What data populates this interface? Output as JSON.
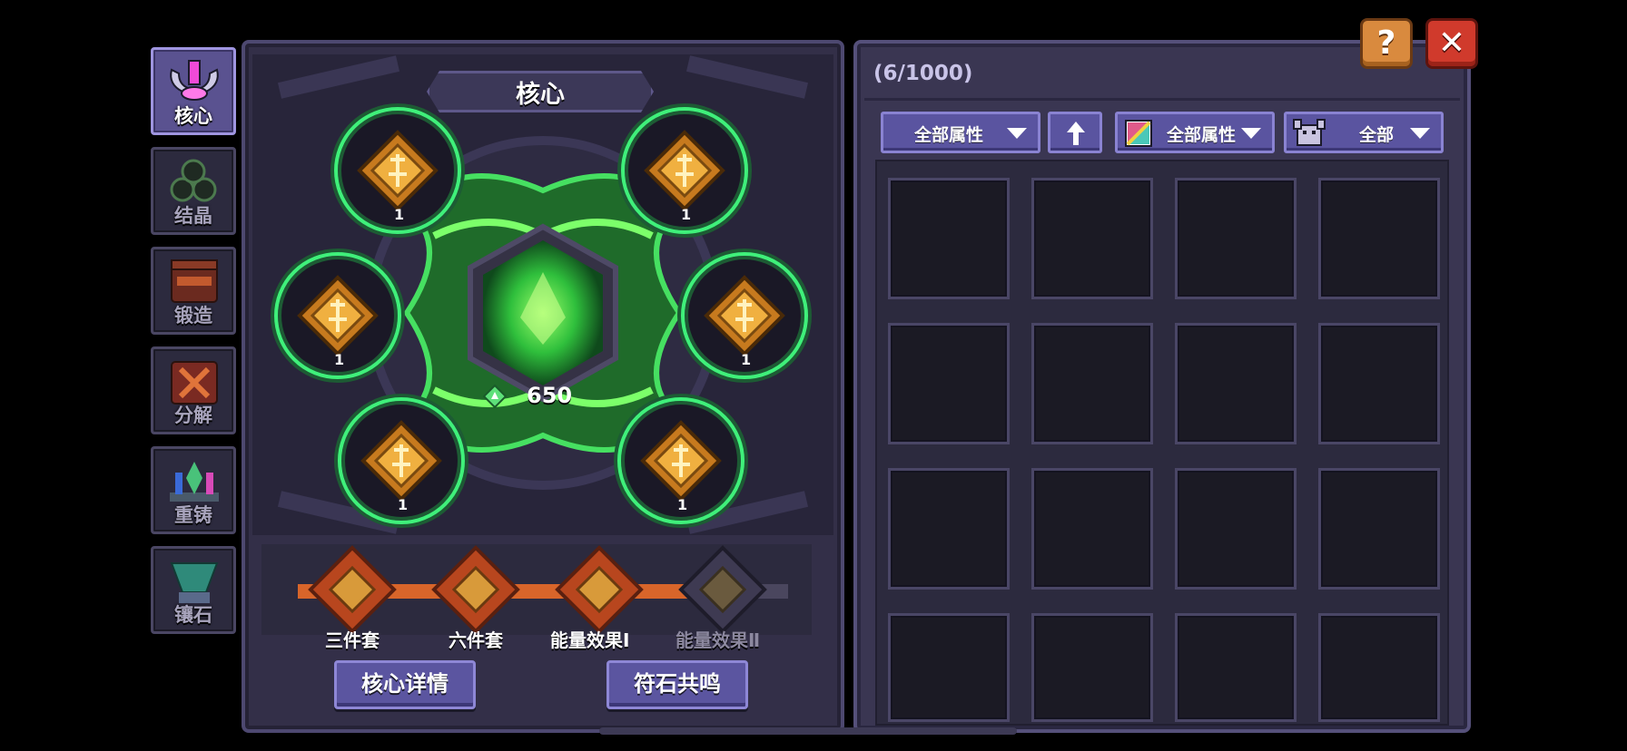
{
  "tabs": [
    {
      "label": "核心",
      "icon": "core-vase-icon",
      "active": true
    },
    {
      "label": "结晶",
      "icon": "crystal-icon",
      "active": false
    },
    {
      "label": "锻造",
      "icon": "forge-icon",
      "active": false
    },
    {
      "label": "分解",
      "icon": "decompose-icon",
      "active": false
    },
    {
      "label": "重铸",
      "icon": "reforge-icon",
      "active": false
    },
    {
      "label": "镶石",
      "icon": "inlay-icon",
      "active": false
    }
  ],
  "core": {
    "title": "核心",
    "energy": "650",
    "slots": [
      {
        "level": "1"
      },
      {
        "level": "1"
      },
      {
        "level": "1"
      },
      {
        "level": "1"
      },
      {
        "level": "1"
      },
      {
        "level": "1"
      }
    ],
    "sets": [
      {
        "label": "三件套",
        "active": true
      },
      {
        "label": "六件套",
        "active": true
      },
      {
        "label": "能量效果Ⅰ",
        "active": true
      },
      {
        "label": "能量效果Ⅱ",
        "active": false
      }
    ],
    "details_button": "核心详情",
    "resonance_button": "符石共鸣"
  },
  "inventory": {
    "count": "(6/1000)",
    "filters": {
      "attribute": "全部属性",
      "sort_icon": "arrow-up-icon",
      "element": "全部属性",
      "type": "全部"
    }
  },
  "top_buttons": {
    "help": "?",
    "close": "✕"
  },
  "colors": {
    "accent_green": "#3ff07a",
    "panel": "#332f48",
    "button_purple": "#5b55a0",
    "help_orange": "#d98a3e",
    "close_red": "#d03a2c"
  }
}
